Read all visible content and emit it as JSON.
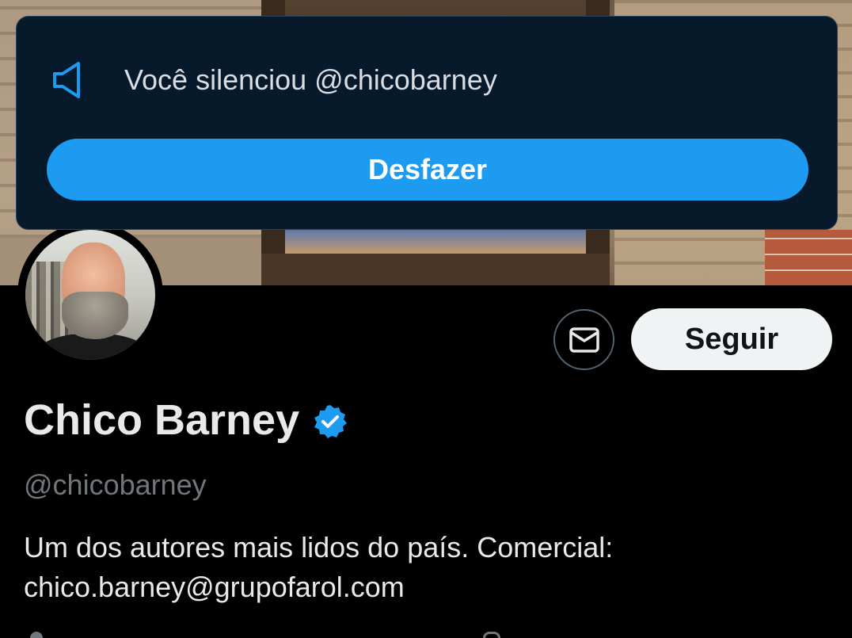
{
  "toast": {
    "icon": "muted-speaker-icon",
    "message": "Você silenciou @chicobarney",
    "undo_label": "Desfazer",
    "accent_color": "#1d9bf0"
  },
  "profile": {
    "name": "Chico Barney",
    "verified": true,
    "verified_color": "#1d9bf0",
    "handle": "@chicobarney",
    "bio_line_1": "Um dos autores mais lidos do país. Comercial:",
    "bio_line_2": "chico.barney@grupofarol.com"
  },
  "actions": {
    "message_icon": "envelope-icon",
    "follow_label": "Seguir"
  }
}
